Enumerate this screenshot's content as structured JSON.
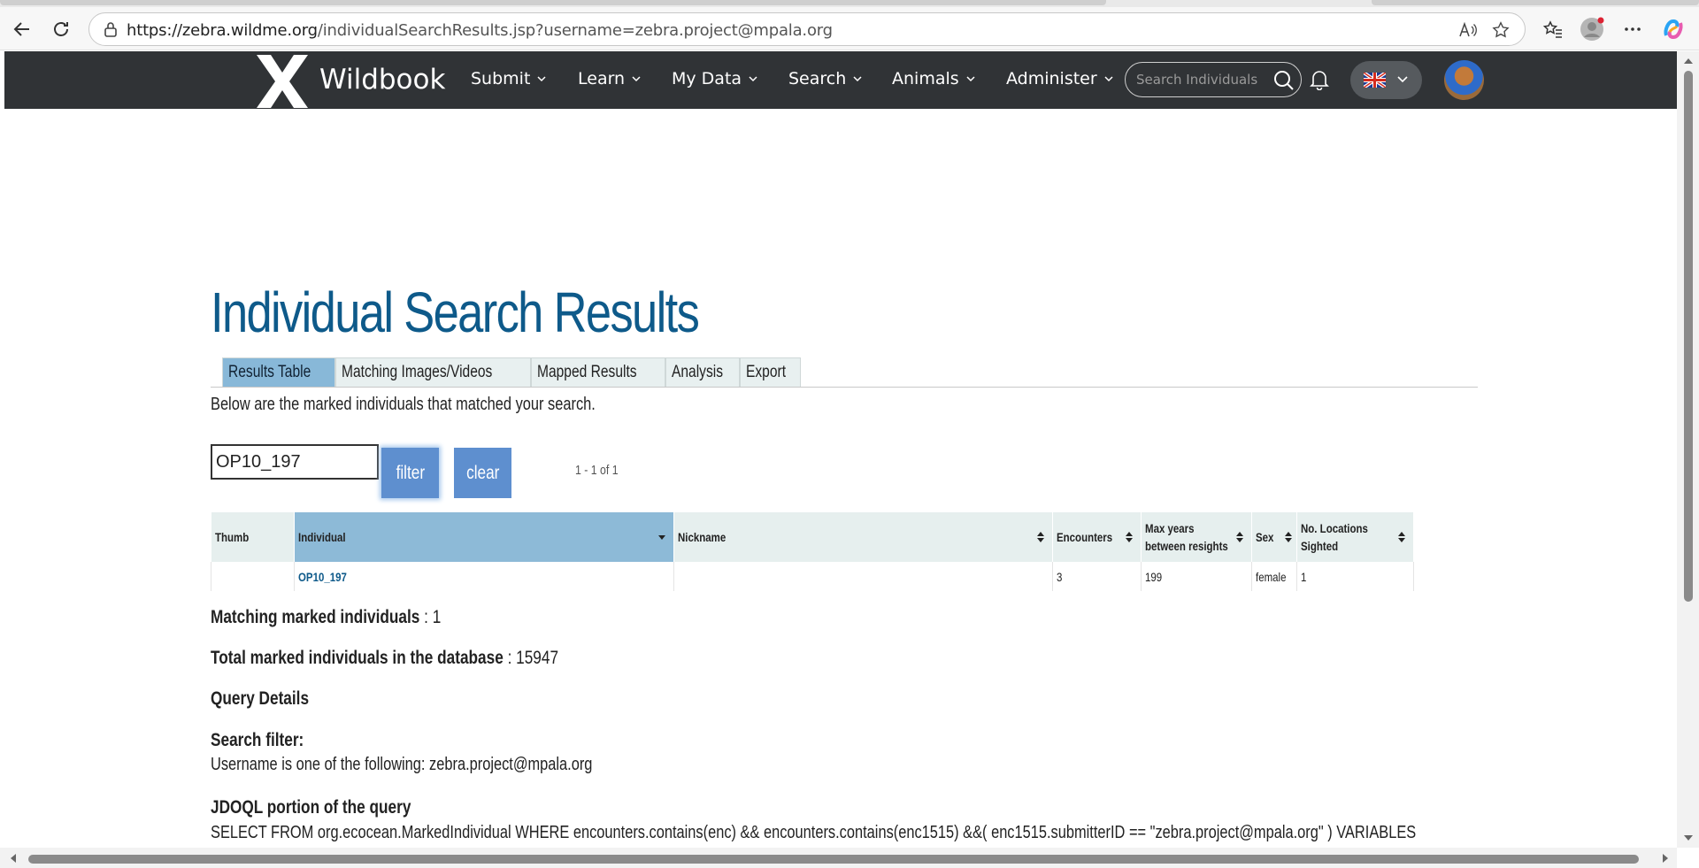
{
  "browser": {
    "url_host": "https://zebra.wildme.org",
    "url_path": "/individualSearchResults.jsp?username=zebra.project@mpala.org"
  },
  "navbar": {
    "brand": "Wildbook",
    "items": [
      {
        "label": "Submit"
      },
      {
        "label": "Learn"
      },
      {
        "label": "My Data"
      },
      {
        "label": "Search"
      },
      {
        "label": "Animals"
      },
      {
        "label": "Administer"
      }
    ],
    "search_placeholder": "Search Individuals"
  },
  "page": {
    "title": "Individual Search Results",
    "tabs": [
      {
        "label": "Results Table",
        "active": true
      },
      {
        "label": "Matching Images/Videos"
      },
      {
        "label": "Mapped Results"
      },
      {
        "label": "Analysis"
      },
      {
        "label": "Export"
      }
    ],
    "intro": "Below are the marked individuals that matched your search.",
    "filter_value": "OP10_197",
    "filter_label": "filter",
    "clear_label": "clear",
    "pager": "1 - 1 of 1"
  },
  "table": {
    "headers": {
      "thumb": "Thumb",
      "individual": "Individual",
      "nickname": "Nickname",
      "encounters": "Encounters",
      "max_years_1": "Max years",
      "max_years_2": "between resights",
      "sex": "Sex",
      "locations_1": "No. Locations",
      "locations_2": "Sighted"
    },
    "rows": [
      {
        "thumb": "",
        "individual": "OP10_197",
        "nickname": "",
        "encounters": "3",
        "max_years": "199",
        "sex": "female",
        "locations": "1"
      }
    ]
  },
  "stats": {
    "matching_label": "Matching marked individuals",
    "matching_value": " : 1",
    "total_label": "Total marked individuals in the database",
    "total_value": " : 15947"
  },
  "query": {
    "details_heading": "Query Details",
    "filter_heading": "Search filter:",
    "filter_text": "Username is one of the following: zebra.project@mpala.org",
    "jdoql_heading": "JDOQL portion of the query",
    "jdoql_text": "SELECT FROM org.ecocean.MarkedIndividual WHERE encounters.contains(enc) && encounters.contains(enc1515) &&( enc1515.submitterID == \"zebra.project@mpala.org\" ) VARIABLES"
  },
  "colors": {
    "navbar_bg": "#303336",
    "title": "#0e5a8a",
    "button": "#5e8fcf",
    "active_tab": "#88b8d8"
  }
}
